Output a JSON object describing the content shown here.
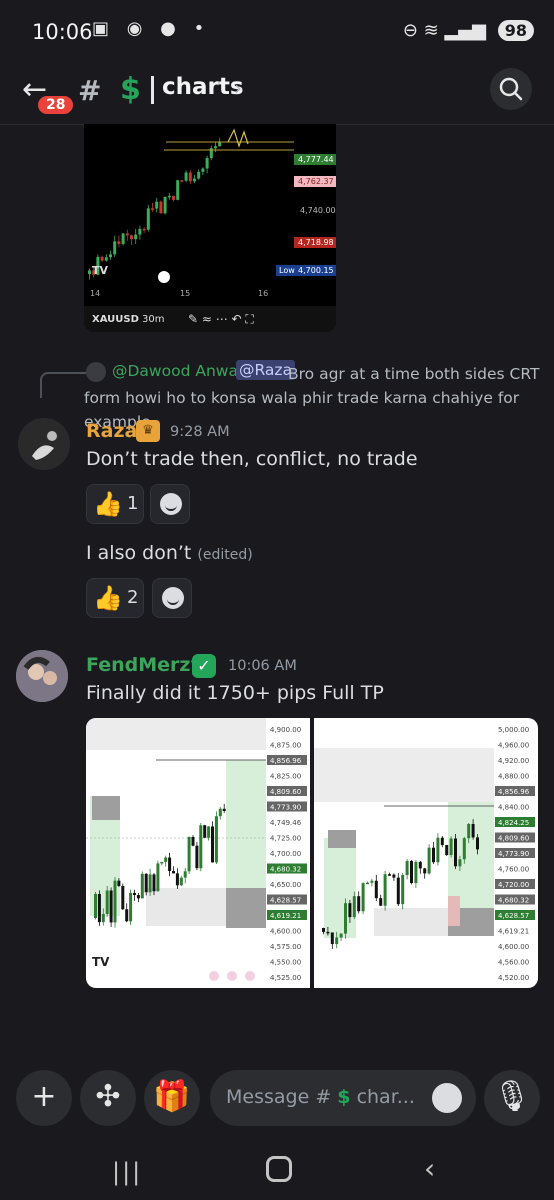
{
  "status_bar": {
    "time": "10:06",
    "battery": "98"
  },
  "header": {
    "unread_count": "28",
    "channel_prefix_symbol": "#",
    "channel_emoji": "$",
    "channel_name": "charts"
  },
  "top_chart_image": {
    "price_labels": [
      "4,777.44",
      "4,762.37",
      "4,740.00",
      "4,718.98",
      "4,700.15"
    ],
    "low_label": "Low",
    "time_labels": [
      "14",
      "15",
      "16"
    ],
    "symbol": "XAUUSD",
    "interval": "30m"
  },
  "reply": {
    "author": "@Dawood Anwar",
    "mention": "@Raza",
    "text": "Bro agr at a time both sides CRT form howi ho to konsa wala phir trade karna chahiye for example"
  },
  "message_raza": {
    "author": "Raza",
    "timestamp": "9:28 AM",
    "text": "Don’t trade then, conflict,  no trade",
    "reaction_count": "1",
    "followup_text": "I also don’t",
    "edited_label": "(edited)",
    "followup_reaction_count": "2"
  },
  "message_fend": {
    "author": "FendMerzy",
    "timestamp": "10:06 AM",
    "text": "Finally did it 1750+ pips Full TP"
  },
  "left_chart_image": {
    "price_labels": [
      "4,900.00",
      "4,875.00",
      "4,856.96",
      "4,825.00",
      "4,809.60",
      "4,773.90",
      "4,749.46",
      "4,725.00",
      "4,700.00",
      "4,680.32",
      "4,650.00",
      "4,628.57",
      "4,619.21",
      "4,600.00",
      "4,575.00",
      "4,550.00",
      "4,525.00"
    ]
  },
  "right_chart_image": {
    "price_labels": [
      "5,000.00",
      "4,960.00",
      "4,920.00",
      "4,880.00",
      "4,856.96",
      "4,840.00",
      "4,824.25",
      "4,809.60",
      "4,773.90",
      "4,760.00",
      "4,720.00",
      "4,680.32",
      "4,628.57",
      "4,619.21",
      "4,600.00",
      "4,560.00",
      "4,520.00"
    ]
  },
  "composer": {
    "placeholder_prefix": "Message #",
    "placeholder_emoji": "$",
    "placeholder_suffix": "char..."
  },
  "icons": [
    "back-arrow-icon",
    "search-icon",
    "crown-icon",
    "verified-icon",
    "thumbs-up-icon",
    "add-reaction-icon",
    "plus-icon",
    "apps-icon",
    "gift-icon",
    "emoji-icon",
    "mic-icon"
  ]
}
